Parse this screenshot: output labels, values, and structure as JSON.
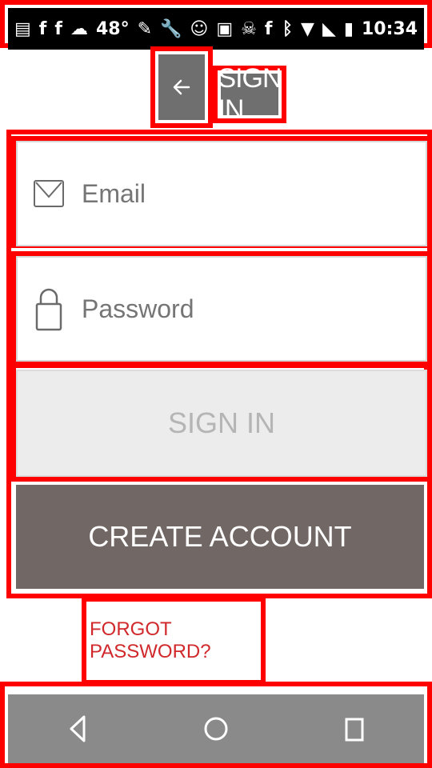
{
  "status_bar": {
    "temperature": "48°",
    "time": "10:34"
  },
  "header": {
    "title": "SIGN IN"
  },
  "form": {
    "email_placeholder": "Email",
    "password_placeholder": "Password",
    "sign_in_label": "SIGN IN",
    "create_account_label": "CREATE ACCOUNT"
  },
  "links": {
    "forgot_password": "FORGOT PASSWORD?"
  },
  "icons": {
    "back": "arrow-left-icon",
    "email": "envelope-icon",
    "password": "lock-icon",
    "nav_back": "triangle-back-icon",
    "nav_home": "circle-home-icon",
    "nav_recent": "square-recent-icon"
  },
  "colors": {
    "frame": "#ff0000",
    "header_bg": "#6f6f6f",
    "create_account_bg": "#716764",
    "forgot_password_text": "#d0282b",
    "nav_bg": "#8a8a8a"
  }
}
